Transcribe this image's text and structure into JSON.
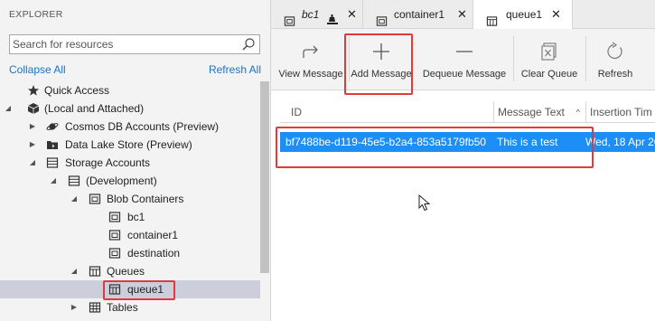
{
  "explorer": {
    "title": "EXPLORER",
    "search_placeholder": "Search for resources",
    "collapse_all": "Collapse All",
    "refresh_all": "Refresh All",
    "tree": [
      {
        "label": "Quick Access"
      },
      {
        "label": "(Local and Attached)"
      },
      {
        "label": "Cosmos DB Accounts (Preview)"
      },
      {
        "label": "Data Lake Store (Preview)"
      },
      {
        "label": "Storage Accounts"
      },
      {
        "label": "(Development)"
      },
      {
        "label": "Blob Containers"
      },
      {
        "label": "bc1"
      },
      {
        "label": "container1"
      },
      {
        "label": "destination"
      },
      {
        "label": "Queues"
      },
      {
        "label": "queue1"
      },
      {
        "label": "Tables"
      }
    ]
  },
  "tabs": [
    {
      "label": "bc1"
    },
    {
      "label": "container1"
    },
    {
      "label": "queue1"
    }
  ],
  "toolbar": {
    "view_message": "View Message",
    "add_message": "Add Message",
    "dequeue_message": "Dequeue Message",
    "clear_queue": "Clear Queue",
    "refresh": "Refresh"
  },
  "grid": {
    "columns": [
      "ID",
      "Message Text",
      "Insertion Tim"
    ],
    "rows": [
      {
        "id": "bf7488be-d119-45e5-b2a4-853a5179fb50",
        "text": "This is a test",
        "inserted": "Wed, 18 Apr 20"
      }
    ]
  },
  "colors": {
    "accent": "#1e8ef7",
    "highlight_box": "#e03a3a",
    "link": "#1a73c8"
  }
}
